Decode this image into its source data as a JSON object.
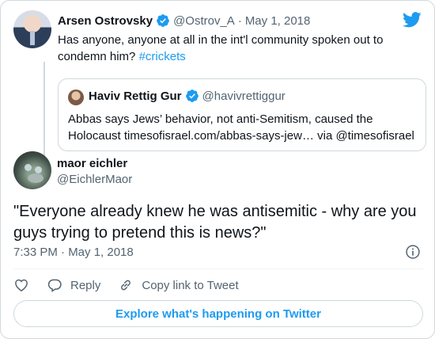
{
  "parent_tweet": {
    "author_name": "Arsen Ostrovsky",
    "author_handle": "@Ostrov_A",
    "separator": "·",
    "date": "May 1, 2018",
    "text": "Has anyone, anyone at all in the int'l community spoken out to condemn him? ",
    "hashtag": "#crickets"
  },
  "quoted_tweet": {
    "author_name": "Haviv Rettig Gur",
    "author_handle": "@havivrettiggur",
    "text": "Abbas says Jews’ behavior, not anti-Semitism, caused the Holocaust timesofisrael.com/abbas-says-jew… via @timesofisrael"
  },
  "tweet": {
    "author_name": "maor eichler",
    "author_handle": "@EichlerMaor",
    "text": "\"Everyone already knew he was antisemitic - why are you guys trying to pretend this is news?\"",
    "timestamp": "7:33 PM · May 1, 2018"
  },
  "actions": {
    "reply_label": "Reply",
    "copy_link_label": "Copy link to Tweet"
  },
  "explore_label": "Explore what's happening on Twitter",
  "colors": {
    "accent": "#1d9bf0",
    "secondary_text": "#536471",
    "border": "#cfd9de"
  },
  "icons": [
    "twitter-bird-icon",
    "verified-badge-icon",
    "info-icon",
    "heart-icon",
    "reply-icon",
    "link-icon"
  ]
}
